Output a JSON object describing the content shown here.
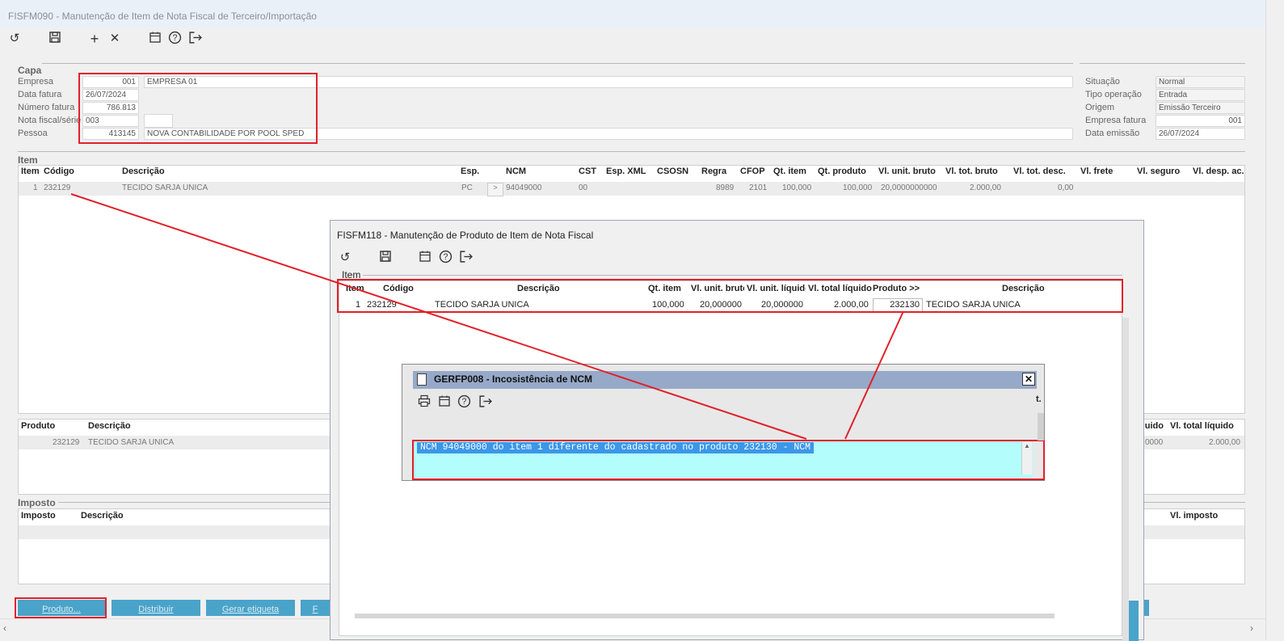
{
  "main": {
    "title": "FISFM090 - Manutenção de Item de Nota Fiscal de Terceiro/Importação",
    "toolbar": [
      "undo-icon",
      "save-icon",
      "add-icon",
      "delete-icon",
      "calendar-icon",
      "help-icon",
      "exit-icon"
    ],
    "capa": {
      "section": "Capa",
      "empresa_label": "Empresa",
      "empresa_code": "001",
      "empresa_name": "EMPRESA 01",
      "data_fatura_label": "Data fatura",
      "data_fatura": "26/07/2024",
      "numero_fatura_label": "Número fatura",
      "numero_fatura": "786.813",
      "nota_fiscal_label": "Nota fiscal/série",
      "nota_fiscal": "003",
      "serie": "",
      "pessoa_label": "Pessoa",
      "pessoa_code": "413145",
      "pessoa_name": "NOVA CONTABILIDADE POR POOL SPED"
    },
    "right": {
      "situacao_label": "Situação",
      "situacao": "Normal",
      "tipo_operacao_label": "Tipo operação",
      "tipo_operacao": "Entrada",
      "origem_label": "Origem",
      "origem": "Emissão Terceiro",
      "empresa_fatura_label": "Empresa fatura",
      "empresa_fatura": "001",
      "data_emissao_label": "Data emissão",
      "data_emissao": "26/07/2024"
    },
    "item": {
      "section": "Item",
      "headers": [
        "Item",
        "Código",
        "Descrição",
        "Esp.",
        "NCM",
        "CST",
        "Esp. XML",
        "CSOSN",
        "Regra",
        "CFOP",
        "Qt. item",
        "Qt. produto",
        "Vl. unit. bruto",
        "Vl. tot. bruto",
        "Vl. tot. desc.",
        "Vl. frete",
        "Vl. seguro",
        "Vl. desp. ac."
      ],
      "row": {
        "item": "1",
        "codigo": "232129",
        "descricao": "TECIDO SARJA UNICA",
        "esp": "PC",
        "btn": ">",
        "ncm": "94049000",
        "cst": "00",
        "regra": "8989",
        "cfop": "2101",
        "qt_item": "100,000",
        "qt_produto": "100,000",
        "vl_unit_bruto": "20,0000000000",
        "vl_tot_bruto": "2.000,00",
        "vl_tot_desc": "0,00"
      }
    },
    "produto": {
      "headers": [
        "Produto",
        "Descrição"
      ],
      "right_headers": [
        "Vl. unit. líquido",
        "Vl. total líquido"
      ],
      "row": {
        "produto": "232129",
        "descricao": "TECIDO SARJA UNICA",
        "vl_unit_liquido": "0000",
        "vl_total_liquido": "2.000,00"
      }
    },
    "imposto": {
      "section": "Imposto",
      "headers": [
        "Imposto",
        "Descrição"
      ],
      "right_header": "Vl. imposto"
    },
    "buttons": {
      "produto": "Produto...",
      "distribuir": "Distribuir",
      "gerar_etiqueta": "Gerar etiqueta",
      "more": "F"
    }
  },
  "dialog_product": {
    "title": "FISFM118 - Manutenção de Produto de Item de Nota Fiscal",
    "toolbar": [
      "undo-icon",
      "save-icon",
      "calendar-icon",
      "help-icon",
      "exit-icon"
    ],
    "section": "Item",
    "headers": [
      "Item",
      "Código",
      "Descrição",
      "Qt. item",
      "Vl. unit. bruto",
      "Vl. unit. líquido",
      "Vl. total líquido",
      "Produto >>",
      "Descrição"
    ],
    "row": {
      "item": "1",
      "codigo": "232129",
      "descricao": "TECIDO SARJA UNICA",
      "qt_item": "100,000",
      "vl_unit_bruto": "20,000000",
      "vl_unit_liquido": "20,000000",
      "vl_total_liquido": "2.000,00",
      "produto": "232130",
      "descricao2": "TECIDO SARJA UNICA"
    }
  },
  "dialog_ncm": {
    "title": "GERFP008 - Incosistência de NCM",
    "toolbar": [
      "print-icon",
      "calendar-icon",
      "help-icon",
      "exit-icon"
    ],
    "close": "✕",
    "message": "NCM 94049000 do item 1 diferente do cadastrado no produto 232130 - NCM",
    "partial_header": "t."
  },
  "colors": {
    "highlight_box": "#e0202a",
    "message_bg": "#b3fdfd",
    "selection": "#3b97e8",
    "button": "#4aa3c9"
  }
}
